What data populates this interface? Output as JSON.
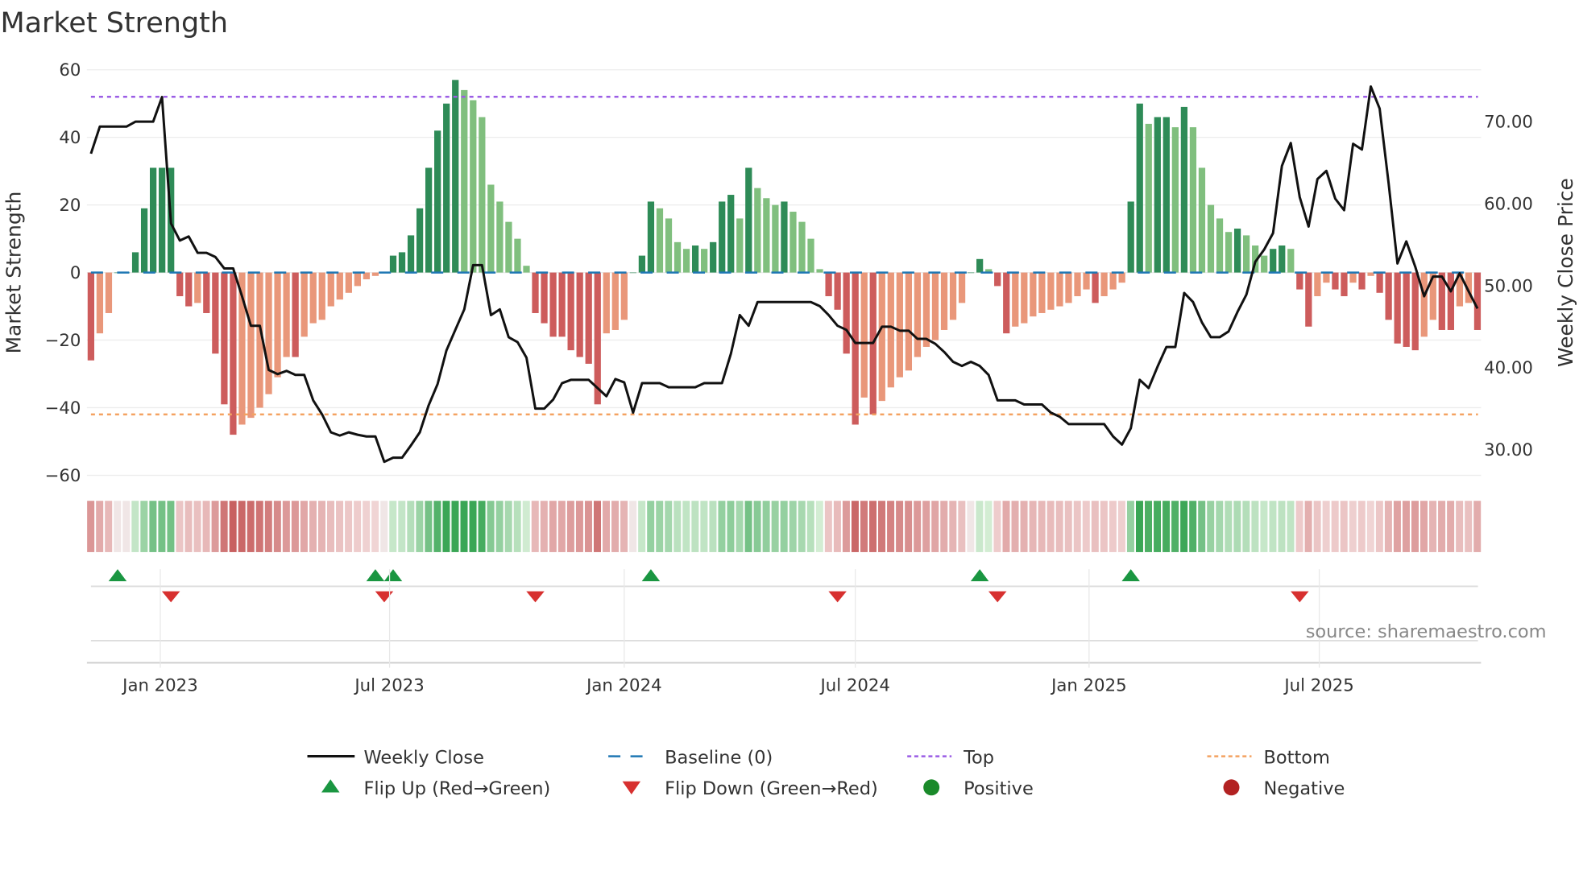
{
  "chart_data": {
    "type": "bar",
    "title": "Market Strength",
    "ylabel": "Market Strength",
    "y2label": "Weekly Close Price",
    "ylim": [
      -60,
      60
    ],
    "y2lim": [
      25,
      76.2
    ],
    "yticks": [
      60,
      40,
      20,
      0,
      -20,
      -40,
      -60
    ],
    "yticklabels": [
      "60",
      "40",
      "20",
      "0",
      "−20",
      "−40",
      "−60"
    ],
    "y2ticks": [
      70,
      60,
      50,
      40,
      30
    ],
    "y2ticklabels": [
      "70.00",
      "60.00",
      "50.00",
      "40.00",
      "30.00"
    ],
    "x_unit": "week index",
    "xticks": [
      {
        "pos": 7.8,
        "label": "Jan 2023"
      },
      {
        "pos": 33.6,
        "label": "Jul 2023"
      },
      {
        "pos": 60.0,
        "label": "Jan 2024"
      },
      {
        "pos": 86.0,
        "label": "Jul 2024"
      },
      {
        "pos": 112.3,
        "label": "Jan 2025"
      },
      {
        "pos": 138.2,
        "label": "Jul 2025"
      }
    ],
    "top_level": 52,
    "bottom_level": -42,
    "baseline": 0,
    "strength": [
      -26,
      -18,
      -12,
      0,
      0,
      6,
      19,
      31,
      31,
      31,
      -7,
      -10,
      -9,
      -12,
      -24,
      -39,
      -48,
      -45,
      -43,
      -40,
      -36,
      -31,
      -25,
      -25,
      -19,
      -15,
      -14,
      -10,
      -8,
      -6,
      -4,
      -2,
      -1,
      0,
      5,
      6,
      11,
      19,
      31,
      42,
      50,
      57,
      54,
      51,
      46,
      26,
      21,
      15,
      10,
      2,
      -12,
      -15,
      -19,
      -19,
      -23,
      -25,
      -27,
      -39,
      -18,
      -17,
      -14,
      0,
      5,
      21,
      19,
      16,
      9,
      7,
      8,
      7,
      9,
      21,
      23,
      16,
      31,
      25,
      22,
      20,
      21,
      18,
      15,
      10,
      1,
      -7,
      -11,
      -24,
      -45,
      -37,
      -42,
      -38,
      -34,
      -31,
      -29,
      -25,
      -22,
      -20,
      -17,
      -14,
      -9,
      0,
      4,
      1,
      -4,
      -18,
      -16,
      -15,
      -13,
      -12,
      -11,
      -10,
      -9,
      -7,
      -5,
      -9,
      -7,
      -5,
      -3,
      21,
      50,
      44,
      46,
      46,
      43,
      49,
      43,
      31,
      20,
      16,
      12,
      13,
      11,
      8,
      5,
      7,
      8,
      7,
      -5,
      -16,
      -7,
      -3,
      -5,
      -7,
      -3,
      -5,
      -1,
      -6,
      -14,
      -21,
      -22,
      -23,
      -19,
      -14,
      -17,
      -17,
      -10,
      -9,
      -17
    ],
    "weekly_close": [
      66.1,
      69.4,
      69.4,
      69.4,
      69.4,
      70.0,
      70.0,
      70.0,
      73.0,
      57.6,
      55.5,
      56.0,
      54.0,
      54.0,
      53.5,
      52.1,
      52.1,
      48.7,
      45.1,
      45.1,
      39.7,
      39.2,
      39.6,
      39.1,
      39.1,
      36.0,
      34.3,
      32.1,
      31.7,
      32.1,
      31.8,
      31.6,
      31.6,
      28.5,
      29.0,
      29.0,
      30.5,
      32.1,
      35.4,
      38.0,
      42.1,
      44.6,
      47.1,
      52.5,
      52.5,
      46.4,
      47.1,
      43.7,
      43.1,
      41.2,
      35.0,
      35.0,
      36.1,
      38.1,
      38.5,
      38.5,
      38.5,
      37.5,
      36.5,
      38.6,
      38.2,
      34.5,
      38.1,
      38.1,
      38.1,
      37.6,
      37.6,
      37.6,
      37.6,
      38.1,
      38.1,
      38.1,
      41.7,
      46.4,
      45.1,
      48.0,
      48.0,
      48.0,
      48.0,
      48.0,
      48.0,
      48.0,
      47.5,
      46.4,
      45.1,
      44.6,
      43.0,
      43.0,
      43.0,
      45.0,
      45.0,
      44.5,
      44.5,
      43.5,
      43.5,
      42.9,
      41.9,
      40.7,
      40.2,
      40.7,
      40.2,
      39.1,
      36.0,
      36.0,
      36.0,
      35.5,
      35.5,
      35.5,
      34.5,
      34.0,
      33.1,
      33.1,
      33.1,
      33.1,
      33.1,
      31.6,
      30.6,
      32.6,
      38.5,
      37.5,
      40.1,
      42.5,
      42.5,
      49.1,
      48.0,
      45.5,
      43.7,
      43.7,
      44.4,
      46.8,
      48.9,
      52.9,
      54.4,
      56.4,
      64.6,
      67.4,
      60.8,
      57.2,
      63.0,
      64.0,
      60.6,
      59.2,
      67.3,
      66.6,
      74.3,
      71.6,
      62.5,
      52.7,
      55.4,
      52.3,
      48.7,
      51.1,
      51.1,
      49.3,
      51.5,
      49.3,
      47.2
    ],
    "flip_up_weeks": [
      3,
      32,
      34,
      63,
      100,
      117
    ],
    "flip_down_weeks": [
      9,
      33,
      50,
      84,
      102,
      136
    ],
    "colors": {
      "pos_rising": "#2e8b57",
      "pos_falling": "#80bf7e",
      "neg_falling": "#cd5c5c",
      "neg_rising": "#e9977a",
      "close": "#111111",
      "baseline": "#1f77b4",
      "top": "#9b5de5",
      "bottom": "#f4a261",
      "flip_up": "#1a9641",
      "flip_down": "#d7302f",
      "positive": "#1a8a2a",
      "negative": "#b22222"
    },
    "legend": [
      {
        "key": "close",
        "label": "Weekly Close"
      },
      {
        "key": "baseline",
        "label": "Baseline (0)"
      },
      {
        "key": "top",
        "label": "Top"
      },
      {
        "key": "bottom",
        "label": "Bottom"
      },
      {
        "key": "flip_up",
        "label": "Flip Up (Red→Green)"
      },
      {
        "key": "flip_down",
        "label": "Flip Down (Green→Red)"
      },
      {
        "key": "positive",
        "label": "Positive"
      },
      {
        "key": "negative",
        "label": "Negative"
      }
    ],
    "legend_position": "bottom"
  },
  "source": "source: sharemaestro.com"
}
